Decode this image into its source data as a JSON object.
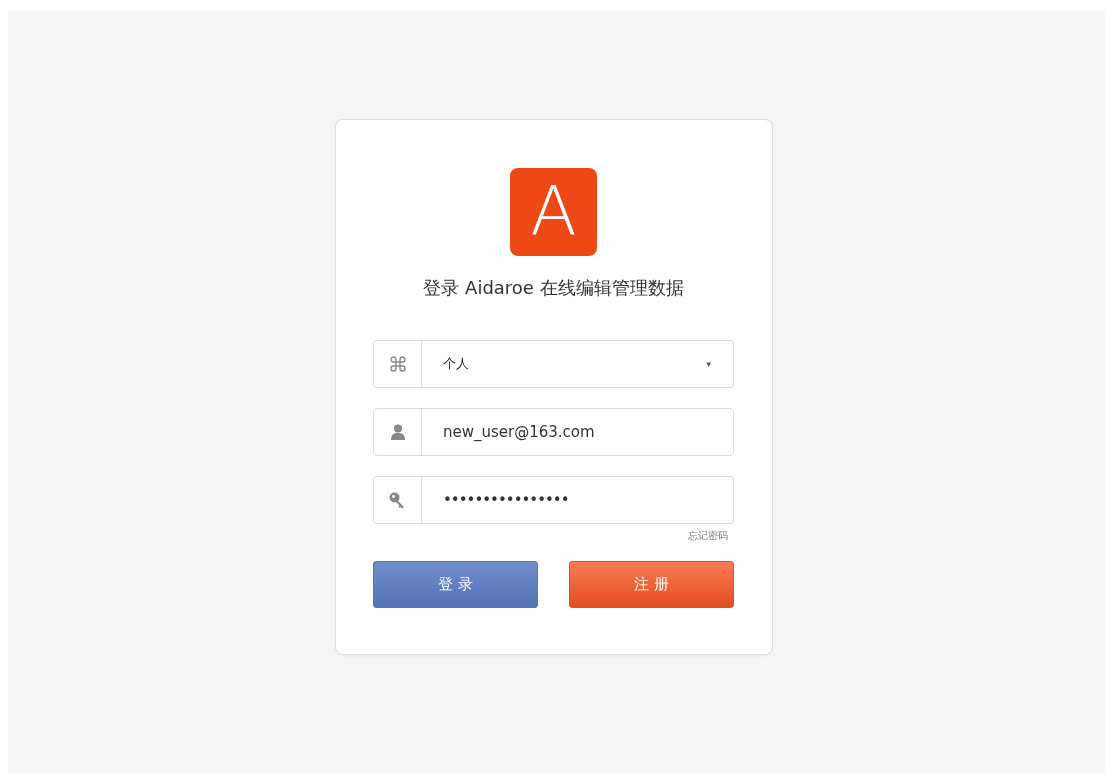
{
  "logo": {
    "letter": "A"
  },
  "title": "登录 Aidaroe 在线编辑管理数据",
  "fields": [
    {
      "kind": "select",
      "value": "个人",
      "caret": "▾"
    },
    {
      "kind": "text",
      "value": "new_user@163.com"
    },
    {
      "kind": "password",
      "value": "••••••••••••••••"
    }
  ],
  "forgot_link": "忘记密码",
  "buttons": [
    {
      "label": "登 录",
      "kind": "primary"
    },
    {
      "label": "注 册",
      "kind": "accent"
    }
  ]
}
